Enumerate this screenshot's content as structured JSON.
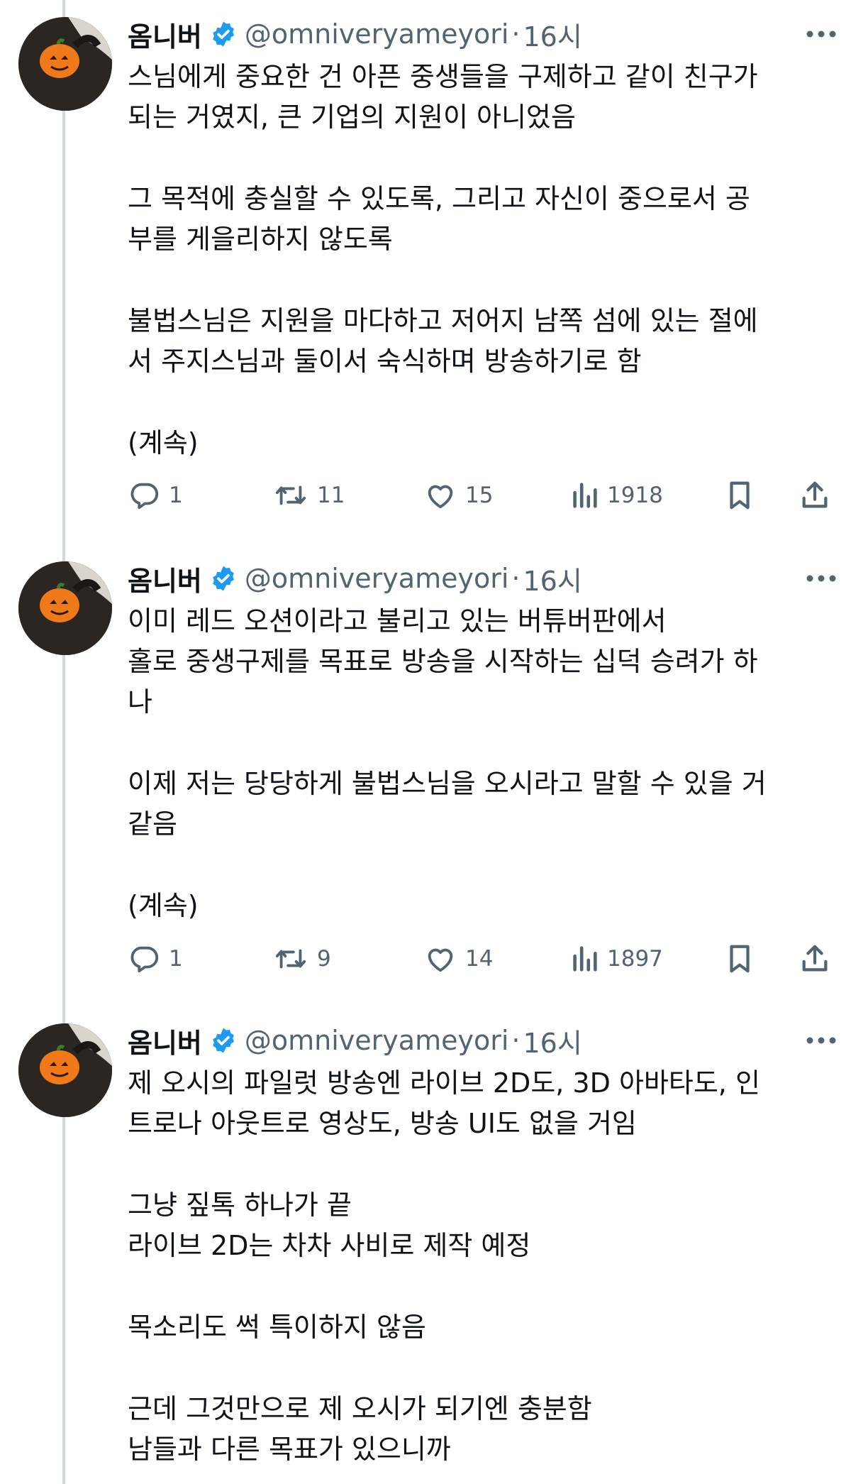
{
  "tweets": [
    {
      "author": {
        "name": "옴니버",
        "handle": "@omniveryameyori",
        "time": "16시"
      },
      "paragraphs": [
        [
          "스님에게 중요한 건 아픈 중생들을 구제하고 같이 친구가",
          "되는 거였지, 큰 기업의 지원이 아니었음"
        ],
        [
          "그 목적에 충실할 수 있도록, 그리고 자신이 중으로서 공",
          "부를 게을리하지 않도록"
        ],
        [
          "불법스님은 지원을 마다하고 저어지 남쪽 섬에 있는 절에",
          "서 주지스님과 둘이서 숙식하며 방송하기로 함"
        ],
        [
          "(계속)"
        ]
      ],
      "stats": {
        "replies": "1",
        "reposts": "11",
        "likes": "15",
        "views": "1918"
      }
    },
    {
      "author": {
        "name": "옴니버",
        "handle": "@omniveryameyori",
        "time": "16시"
      },
      "paragraphs": [
        [
          "이미 레드 오션이라고 불리고 있는 버튜버판에서",
          "홀로 중생구제를 목표로 방송을 시작하는 십덕 승려가 하",
          "나"
        ],
        [
          "이제 저는 당당하게 불법스님을 오시라고 말할 수 있을 거",
          "같음"
        ],
        [
          "(계속)"
        ]
      ],
      "stats": {
        "replies": "1",
        "reposts": "9",
        "likes": "14",
        "views": "1897"
      }
    },
    {
      "author": {
        "name": "옴니버",
        "handle": "@omniveryameyori",
        "time": "16시"
      },
      "paragraphs": [
        [
          "제 오시의 파일럿 방송엔 라이브 2D도, 3D 아바타도, 인",
          "트로나 아웃트로 영상도, 방송 UI도 없을 거임"
        ],
        [
          "그냥 짚톡 하나가 끝",
          "라이브 2D는 차차 사비로 제작 예정"
        ],
        [
          "목소리도 썩 특이하지 않음"
        ],
        [
          "근데 그것만으로 제 오시가 되기엔 충분함",
          "남들과 다른 목표가 있으니까"
        ]
      ],
      "stats": null
    }
  ],
  "icons": {
    "verified": "verified-badge-icon",
    "more": "more-options-icon",
    "reply": "reply-icon",
    "repost": "repost-icon",
    "like": "heart-icon",
    "views": "views-chart-icon",
    "bookmark": "bookmark-icon",
    "share": "share-icon"
  },
  "colors": {
    "text": "#0f1419",
    "secondary": "#536471",
    "verified": "#1d9bf0",
    "thread_line": "#cfd9de",
    "pumpkin": "#f07a1a"
  }
}
